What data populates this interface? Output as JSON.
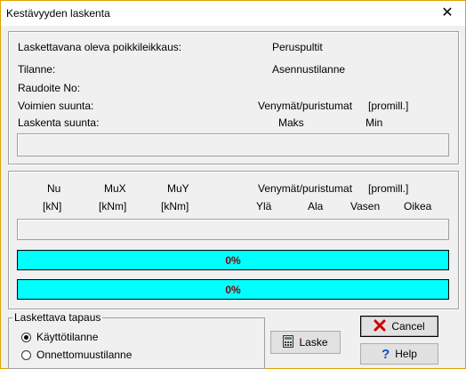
{
  "window": {
    "title": "Kestävyyden laskenta",
    "close": "✕"
  },
  "info": {
    "section_label": "Laskettavana oleva poikkileikkaus:",
    "section_value": "Peruspultit",
    "state_label": "Tilanne:",
    "state_value": "Asennustilanne",
    "rebar_label": "Raudoite No:",
    "force_dir_label": "Voimien suunta:",
    "strains_header": "Venymät/puristumat",
    "unit": "[promill.]",
    "calc_dir_label": "Laskenta suunta:",
    "max_label": "Maks",
    "min_label": "Min"
  },
  "results": {
    "columns": [
      "Nu",
      "MuX",
      "MuY"
    ],
    "units": [
      "[kN]",
      "[kNm]",
      "[kNm]"
    ],
    "strains_header": "Venymät/puristumat",
    "unit": "[promill.]",
    "directions": [
      "Ylä",
      "Ala",
      "Vasen",
      "Oikea"
    ],
    "progress1": "0%",
    "progress2": "0%"
  },
  "case": {
    "legend": "Laskettava tapaus",
    "options": [
      "Käyttötilanne",
      "Onnettomuustilanne"
    ],
    "selected": "Käyttötilanne"
  },
  "buttons": {
    "calculate": "Laske",
    "cancel": "Cancel",
    "help": "Help"
  },
  "colors": {
    "progress_fill": "#00ffff",
    "progress_text": "#800000",
    "cancel_icon": "#cc0000",
    "help_icon": "#0050c8"
  }
}
